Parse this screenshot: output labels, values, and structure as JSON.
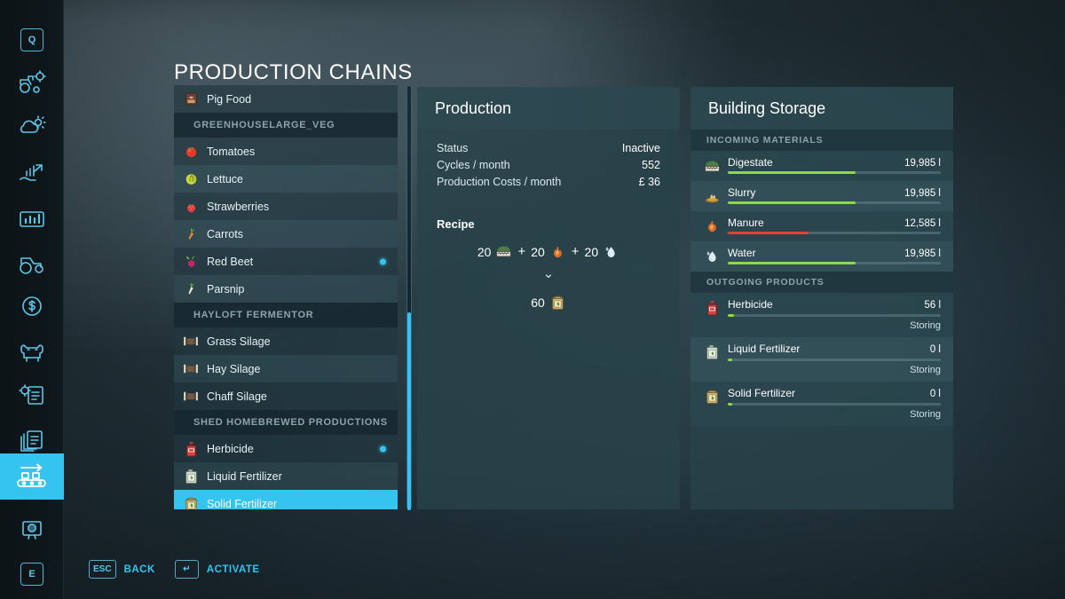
{
  "page_title": "PRODUCTION CHAINS",
  "sidebar": {
    "items": [
      {
        "name": "quick-menu-key",
        "icon": "q-keycap",
        "label": "Q",
        "selected": false
      },
      {
        "name": "vehicle-config",
        "icon": "tractor-gear-icon",
        "label": "",
        "selected": false
      },
      {
        "name": "weather",
        "icon": "weather-cloud-sun-icon",
        "label": "",
        "selected": false
      },
      {
        "name": "prices",
        "icon": "hand-chart-icon",
        "label": "",
        "selected": false
      },
      {
        "name": "statistics",
        "icon": "bar-chart-screen-icon",
        "label": "",
        "selected": false
      },
      {
        "name": "vehicles",
        "icon": "tractor-icon",
        "label": "",
        "selected": false
      },
      {
        "name": "finances",
        "icon": "dollar-circle-icon",
        "label": "",
        "selected": false
      },
      {
        "name": "animals",
        "icon": "cow-icon",
        "label": "",
        "selected": false
      },
      {
        "name": "contracts",
        "icon": "gear-document-icon",
        "label": "",
        "selected": false
      },
      {
        "name": "documents",
        "icon": "documents-icon",
        "label": "",
        "selected": false
      },
      {
        "name": "production-chains",
        "icon": "conveyor-belt-icon",
        "label": "",
        "selected": true
      },
      {
        "name": "map-overview",
        "icon": "map-screen-icon",
        "label": "",
        "selected": false
      },
      {
        "name": "extra-menu-key",
        "icon": "e-keycap",
        "label": "E",
        "selected": false
      }
    ]
  },
  "chain_list": {
    "rows": [
      {
        "type": "item",
        "label": "Pig Food",
        "icon": "pig-food-icon",
        "dot": false,
        "selected": false
      },
      {
        "type": "header",
        "label": "GREENHOUSELARGE_VEG",
        "icon": "",
        "dot": false,
        "selected": false
      },
      {
        "type": "item",
        "label": "Tomatoes",
        "icon": "tomato-icon",
        "dot": false,
        "selected": false
      },
      {
        "type": "item",
        "label": "Lettuce",
        "icon": "lettuce-icon",
        "dot": false,
        "selected": false
      },
      {
        "type": "item",
        "label": "Strawberries",
        "icon": "strawberry-icon",
        "dot": false,
        "selected": false
      },
      {
        "type": "item",
        "label": "Carrots",
        "icon": "carrot-icon",
        "dot": false,
        "selected": false
      },
      {
        "type": "item",
        "label": "Red Beet",
        "icon": "red-beet-icon",
        "dot": true,
        "selected": false
      },
      {
        "type": "item",
        "label": "Parsnip",
        "icon": "parsnip-icon",
        "dot": false,
        "selected": false
      },
      {
        "type": "header",
        "label": "HAYLOFT FERMENTOR",
        "icon": "",
        "dot": false,
        "selected": false
      },
      {
        "type": "item",
        "label": "Grass Silage",
        "icon": "silage-bale-icon",
        "dot": false,
        "selected": false
      },
      {
        "type": "item",
        "label": "Hay Silage",
        "icon": "silage-bale-icon",
        "dot": false,
        "selected": false
      },
      {
        "type": "item",
        "label": "Chaff Silage",
        "icon": "silage-bale-icon",
        "dot": false,
        "selected": false
      },
      {
        "type": "header",
        "label": "SHED HOMEBREWED PRODUCTIONS",
        "icon": "",
        "dot": false,
        "selected": false
      },
      {
        "type": "item",
        "label": "Herbicide",
        "icon": "herbicide-bottle-icon",
        "dot": true,
        "selected": false
      },
      {
        "type": "item",
        "label": "Liquid Fertilizer",
        "icon": "liquid-fertilizer-icon",
        "dot": false,
        "selected": false
      },
      {
        "type": "item",
        "label": "Solid Fertilizer",
        "icon": "solid-fertilizer-icon",
        "dot": false,
        "selected": true
      }
    ]
  },
  "production": {
    "title": "Production",
    "stats": [
      {
        "label": "Status",
        "value": "Inactive"
      },
      {
        "label": "Cycles / month",
        "value": "552"
      },
      {
        "label": "Production Costs / month",
        "value": "£ 36"
      }
    ],
    "recipe_label": "Recipe",
    "recipe": {
      "inputs": [
        {
          "amount": "20",
          "icon": "digestate-icon"
        },
        {
          "amount": "20",
          "icon": "manure-icon"
        },
        {
          "amount": "20",
          "icon": "water-drop-icon"
        }
      ],
      "arrow": "⌄",
      "outputs": [
        {
          "amount": "60",
          "icon": "solid-fertilizer-icon"
        }
      ]
    }
  },
  "storage": {
    "title": "Building Storage",
    "incoming_title": "INCOMING MATERIALS",
    "outgoing_title": "OUTGOING PRODUCTS",
    "incoming": [
      {
        "name": "Digestate",
        "amount": "19,985 l",
        "fill": 60,
        "bar_color": "#8cd94a",
        "icon": "digestate-icon"
      },
      {
        "name": "Slurry",
        "amount": "19,985 l",
        "fill": 60,
        "bar_color": "#8cd94a",
        "icon": "slurry-icon"
      },
      {
        "name": "Manure",
        "amount": "12,585 l",
        "fill": 38,
        "bar_color": "#e0403f",
        "icon": "manure-icon"
      },
      {
        "name": "Water",
        "amount": "19,985 l",
        "fill": 60,
        "bar_color": "#8cd94a",
        "icon": "water-drop-icon"
      }
    ],
    "outgoing": [
      {
        "name": "Herbicide",
        "amount": "56 l",
        "fill": 3,
        "bar_color": "#8cd94a",
        "status": "Storing",
        "icon": "herbicide-bottle-icon"
      },
      {
        "name": "Liquid Fertilizer",
        "amount": "0 l",
        "fill": 2,
        "bar_color": "#8cd94a",
        "status": "Storing",
        "icon": "liquid-fertilizer-icon"
      },
      {
        "name": "Solid Fertilizer",
        "amount": "0 l",
        "fill": 2,
        "bar_color": "#8cd94a",
        "status": "Storing",
        "icon": "solid-fertilizer-icon"
      }
    ]
  },
  "helpbar": {
    "items": [
      {
        "key": "ESC",
        "label": "BACK"
      },
      {
        "key": "↵",
        "label": "ACTIVATE"
      }
    ]
  },
  "colors": {
    "accent": "#35c3f0",
    "bar_ok": "#8cd94a",
    "bar_low": "#e0403f",
    "panel": "#2a424a"
  }
}
